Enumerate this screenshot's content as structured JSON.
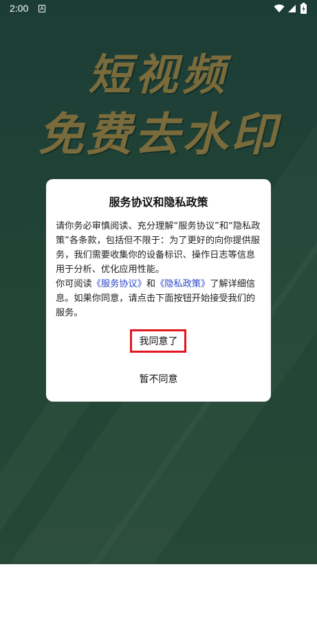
{
  "status_bar": {
    "time": "2:00",
    "notification_icon_letter": "A",
    "icons": [
      "wifi-icon",
      "signal-icon",
      "battery-icon"
    ]
  },
  "banner": {
    "line1": "短视频",
    "line2": "免费去水印",
    "color": "#7a6b3c"
  },
  "dialog": {
    "title": "服务协议和隐私政策",
    "para1": "请你务必审慎阅读、充分理解“服务协议”和“隐私政策”各条款，包括但不限于：为了更好的向你提供服务，我们需要收集你的设备标识、操作日志等信息用于分析、优化应用性能。",
    "para2_prefix": "你可阅读",
    "link_service": "《服务协议》",
    "para2_and": "和",
    "link_privacy": "《隐私政策》",
    "para2_suffix": "了解详细信息。如果你同意，请点击下面按钮开始接受我们的服务。",
    "agree_label": "我同意了",
    "disagree_label": "暂不同意",
    "link_color": "#2b49c9",
    "highlight_color": "#e3151f"
  }
}
